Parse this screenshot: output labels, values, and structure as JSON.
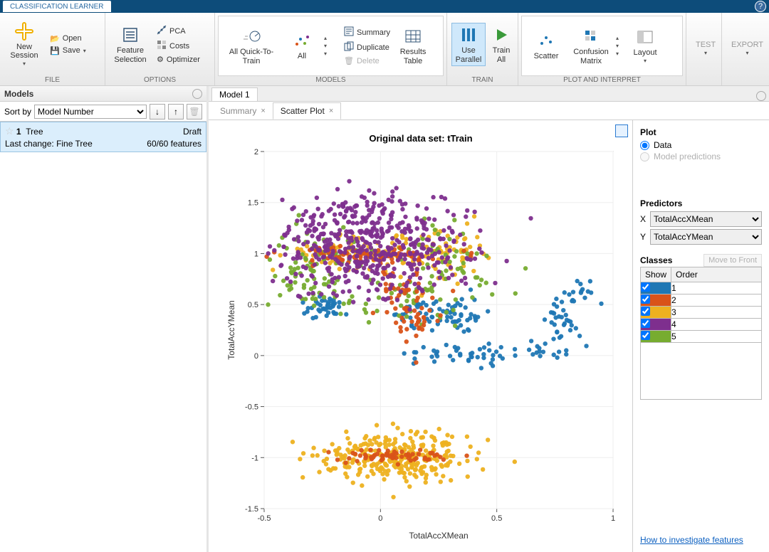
{
  "titlebar": {
    "app": "CLASSIFICATION LEARNER"
  },
  "ribbon": {
    "file": {
      "label": "FILE",
      "new_session": "New\nSession",
      "open": "Open",
      "save": "Save"
    },
    "options": {
      "label": "OPTIONS",
      "feature_selection": "Feature\nSelection",
      "pca": "PCA",
      "costs": "Costs",
      "optimizer": "Optimizer"
    },
    "models": {
      "label": "MODELS",
      "all_quick": "All Quick-To-\nTrain",
      "all": "All",
      "summary": "Summary",
      "duplicate": "Duplicate",
      "delete": "Delete",
      "results": "Results\nTable"
    },
    "train": {
      "label": "TRAIN",
      "use_parallel": "Use\nParallel",
      "train_all": "Train\nAll"
    },
    "plot": {
      "label": "PLOT AND INTERPRET",
      "scatter": "Scatter",
      "confusion": "Confusion\nMatrix",
      "layout": "Layout"
    },
    "test": "TEST",
    "export": "EXPORT"
  },
  "models_panel": {
    "title": "Models",
    "sort_by_label": "Sort by",
    "sort_by_value": "Model Number",
    "item": {
      "num": "1",
      "name": "Tree",
      "status": "Draft",
      "last_change_label": "Last change:",
      "last_change_value": "Fine Tree",
      "features": "60/60 features"
    }
  },
  "doc": {
    "tab": "Model 1",
    "sub_summary": "Summary",
    "sub_scatter": "Scatter Plot"
  },
  "sidepanel": {
    "plot_title": "Plot",
    "radio_data": "Data",
    "radio_pred": "Model predictions",
    "predictors_title": "Predictors",
    "x_label": "X",
    "y_label": "Y",
    "x_value": "TotalAccXMean",
    "y_value": "TotalAccYMean",
    "classes_title": "Classes",
    "move_to_front": "Move to Front",
    "col_show": "Show",
    "col_order": "Order",
    "classes": [
      {
        "order": "1",
        "color": "#1f77b4"
      },
      {
        "order": "2",
        "color": "#d95319"
      },
      {
        "order": "3",
        "color": "#edb120"
      },
      {
        "order": "4",
        "color": "#7e2f8e"
      },
      {
        "order": "5",
        "color": "#77ac30"
      }
    ],
    "help_link": "How to investigate features"
  },
  "chart_data": {
    "type": "scatter",
    "title": "Original data set: tTrain",
    "xlabel": "TotalAccXMean",
    "ylabel": "TotalAccYMean",
    "xlim": [
      -0.5,
      1.0
    ],
    "ylim": [
      -1.5,
      2.0
    ],
    "xticks": [
      -0.5,
      0,
      0.5,
      1
    ],
    "yticks": [
      -1.5,
      -1,
      -0.5,
      0,
      0.5,
      1,
      1.5,
      2
    ],
    "series": [
      {
        "name": "1",
        "color": "#1f77b4",
        "clusters": [
          {
            "cx": -0.25,
            "cy": 0.48,
            "n": 40,
            "sx": 0.04,
            "sy": 0.05
          },
          {
            "cx": 0.25,
            "cy": 0.4,
            "n": 70,
            "sx": 0.1,
            "sy": 0.08
          },
          {
            "cx": 0.35,
            "cy": 0.0,
            "n": 40,
            "sx": 0.12,
            "sy": 0.05
          },
          {
            "cx": 0.68,
            "cy": 0.02,
            "n": 20,
            "sx": 0.1,
            "sy": 0.05
          },
          {
            "cx": 0.78,
            "cy": 0.35,
            "n": 30,
            "sx": 0.05,
            "sy": 0.12
          },
          {
            "cx": 0.85,
            "cy": 0.65,
            "n": 15,
            "sx": 0.05,
            "sy": 0.1
          }
        ]
      },
      {
        "name": "2",
        "color": "#d95319",
        "clusters": [
          {
            "cx": -0.05,
            "cy": 0.98,
            "n": 80,
            "sx": 0.15,
            "sy": 0.04
          },
          {
            "cx": 0.1,
            "cy": 0.6,
            "n": 40,
            "sx": 0.06,
            "sy": 0.15
          },
          {
            "cx": 0.15,
            "cy": 0.35,
            "n": 30,
            "sx": 0.05,
            "sy": 0.12
          },
          {
            "cx": 0.08,
            "cy": -0.98,
            "n": 60,
            "sx": 0.12,
            "sy": 0.03
          }
        ]
      },
      {
        "name": "3",
        "color": "#edb120",
        "clusters": [
          {
            "cx": 0.0,
            "cy": 1.0,
            "n": 120,
            "sx": 0.2,
            "sy": 0.1
          },
          {
            "cx": 0.3,
            "cy": 1.0,
            "n": 40,
            "sx": 0.08,
            "sy": 0.15
          },
          {
            "cx": 0.07,
            "cy": -1.0,
            "n": 300,
            "sx": 0.16,
            "sy": 0.12
          }
        ]
      },
      {
        "name": "4",
        "color": "#7e2f8e",
        "clusters": [
          {
            "cx": -0.05,
            "cy": 1.05,
            "n": 450,
            "sx": 0.22,
            "sy": 0.22
          },
          {
            "cx": -0.1,
            "cy": 1.4,
            "n": 60,
            "sx": 0.12,
            "sy": 0.12
          }
        ]
      },
      {
        "name": "5",
        "color": "#77ac30",
        "clusters": [
          {
            "cx": -0.28,
            "cy": 0.9,
            "n": 80,
            "sx": 0.1,
            "sy": 0.2
          },
          {
            "cx": 0.25,
            "cy": 0.85,
            "n": 60,
            "sx": 0.12,
            "sy": 0.18
          },
          {
            "cx": 0.0,
            "cy": 0.55,
            "n": 40,
            "sx": 0.18,
            "sy": 0.1
          }
        ]
      }
    ]
  }
}
